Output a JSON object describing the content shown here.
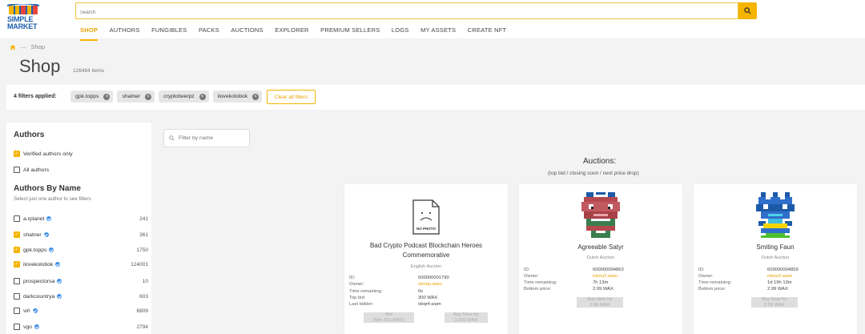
{
  "logo": {
    "line1": "SIMPLE",
    "line2": "MARKET"
  },
  "search": {
    "placeholder": "Search"
  },
  "nav": [
    "SHOP",
    "AUTHORS",
    "FUNGIBLES",
    "PACKS",
    "AUCTIONS",
    "EXPLORER",
    "PREMIUM SELLERS",
    "LOGS",
    "MY ASSETS",
    "CREATE NFT"
  ],
  "breadcrumb": {
    "current": "Shop"
  },
  "page": {
    "title": "Shop",
    "count": "126484 items"
  },
  "filters": {
    "label": "4 filters applied:",
    "chips": [
      "gpk.topps",
      "shatner",
      "cryptotwerpz",
      "ilovekolobok"
    ],
    "clear": "Clear all filters"
  },
  "sidebar": {
    "authors_title": "Authors",
    "verified_label": "Verified authors only",
    "all_label": "All authors",
    "by_name_title": "Authors By Name",
    "by_name_sub": "Select just one author to see filters",
    "authors": [
      {
        "name": "a.rplanet",
        "count": "241",
        "checked": false
      },
      {
        "name": "shatner",
        "count": "361",
        "checked": true
      },
      {
        "name": "gpk.topps",
        "count": "1750",
        "checked": true
      },
      {
        "name": "ilovekolobok",
        "count": "124001",
        "checked": true
      },
      {
        "name": "prospectorsa",
        "count": "10",
        "checked": false
      },
      {
        "name": "darkcountrya",
        "count": "603",
        "checked": false
      },
      {
        "name": "virl",
        "count": "6809",
        "checked": false
      },
      {
        "name": "vgo",
        "count": "2794",
        "checked": false
      }
    ]
  },
  "content": {
    "name_filter_placeholder": "Filter by name",
    "auctions_title": "Auctions:",
    "auctions_sub": "(top bid / closing soon / next price drop)"
  },
  "cards": [
    {
      "name": "Bad Crypto Podcast Blockchain Heroes Commemorative",
      "type": "English Auction",
      "no_photo": "NO PHOTO",
      "rows": [
        {
          "k": "ID:",
          "v": "500000001790"
        },
        {
          "k": "Owner:",
          "v": "ohnqu.wam"
        },
        {
          "k": "Time remaining:",
          "v": "0s"
        },
        {
          "k": "Top bid:",
          "v": "300 WAX"
        },
        {
          "k": "Last bidder:",
          "v": "obqr4.wam"
        }
      ],
      "btn1": [
        "Bid",
        "(Min 310 WAX)"
      ],
      "btn2": [
        "Buy Now for",
        "1,000 WAX"
      ]
    },
    {
      "name": "Agreeable Satyr",
      "type": "Dutch Auction",
      "rows": [
        {
          "k": "ID:",
          "v": "600000004863"
        },
        {
          "k": "Owner:",
          "v": "mkou2.wam"
        },
        {
          "k": "Time remaining:",
          "v": "7h 13m"
        },
        {
          "k": "Bottom price:",
          "v": "2.99 WAX"
        }
      ],
      "btn1": [
        "Buy Now for",
        "2.99 WAX"
      ]
    },
    {
      "name": "Smiting Faun",
      "type": "Dutch Auction",
      "rows": [
        {
          "k": "ID:",
          "v": "600000004859"
        },
        {
          "k": "Owner:",
          "v": "mkou2.wam"
        },
        {
          "k": "Time remaining:",
          "v": "1d 19h 13m"
        },
        {
          "k": "Bottom price:",
          "v": "2.99 WAX"
        }
      ],
      "btn1": [
        "Buy Now for",
        "2.99 WAX"
      ]
    }
  ],
  "colors": {
    "accent": "#f5b400",
    "brand": "#1e5fb0"
  }
}
